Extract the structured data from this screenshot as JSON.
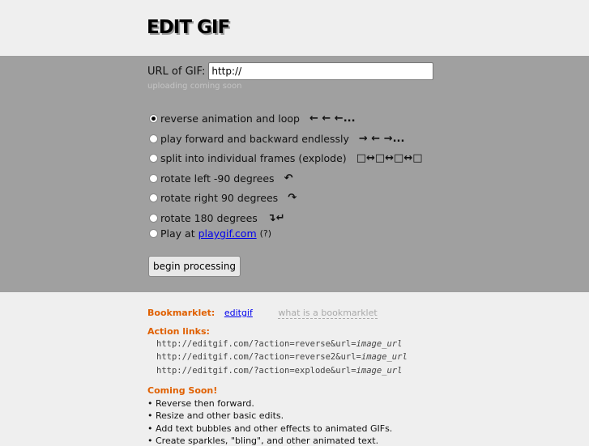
{
  "header": {
    "logo": "EDIT GIF"
  },
  "form": {
    "url_label": "URL of GIF:",
    "url_value": "http://",
    "upload_hint": "uploading coming soon",
    "options": [
      {
        "label": "reverse animation and loop",
        "glyph": "← ← ←...",
        "selected": true
      },
      {
        "label": "play forward and backward endlessly",
        "glyph": "→ ← →...",
        "selected": false
      },
      {
        "label": "split into individual frames (explode)",
        "glyph": "□↔□↔□↔□",
        "selected": false
      },
      {
        "label": "rotate left -90 degrees",
        "glyph": "↶",
        "selected": false
      },
      {
        "label": "rotate right 90 degrees",
        "glyph": "↷",
        "selected": false
      },
      {
        "label": "rotate 180 degrees",
        "glyph": "↴↵",
        "selected": false
      }
    ],
    "play_prefix": "Play at",
    "play_link": "playgif.com",
    "play_help": "(?)",
    "submit_label": "begin processing"
  },
  "footer": {
    "bookmarklet_label": "Bookmarklet:",
    "bookmarklet_link": "editgif",
    "bookmarklet_help": "what is a bookmarklet",
    "action_heading": "Action links:",
    "action_links": [
      {
        "base": "http://editgif.com/?action=reverse&url=",
        "param": "image_url"
      },
      {
        "base": "http://editgif.com/?action=reverse2&url=",
        "param": "image_url"
      },
      {
        "base": "http://editgif.com/?action=explode&url=",
        "param": "image_url"
      }
    ],
    "coming_heading": "Coming Soon!",
    "coming_items": [
      "• Reverse then forward.",
      "• Resize and other basic edits.",
      "• Add text bubbles and other effects to animated GIFs.",
      "• Create sparkles, \"bling\", and other animated text."
    ]
  }
}
